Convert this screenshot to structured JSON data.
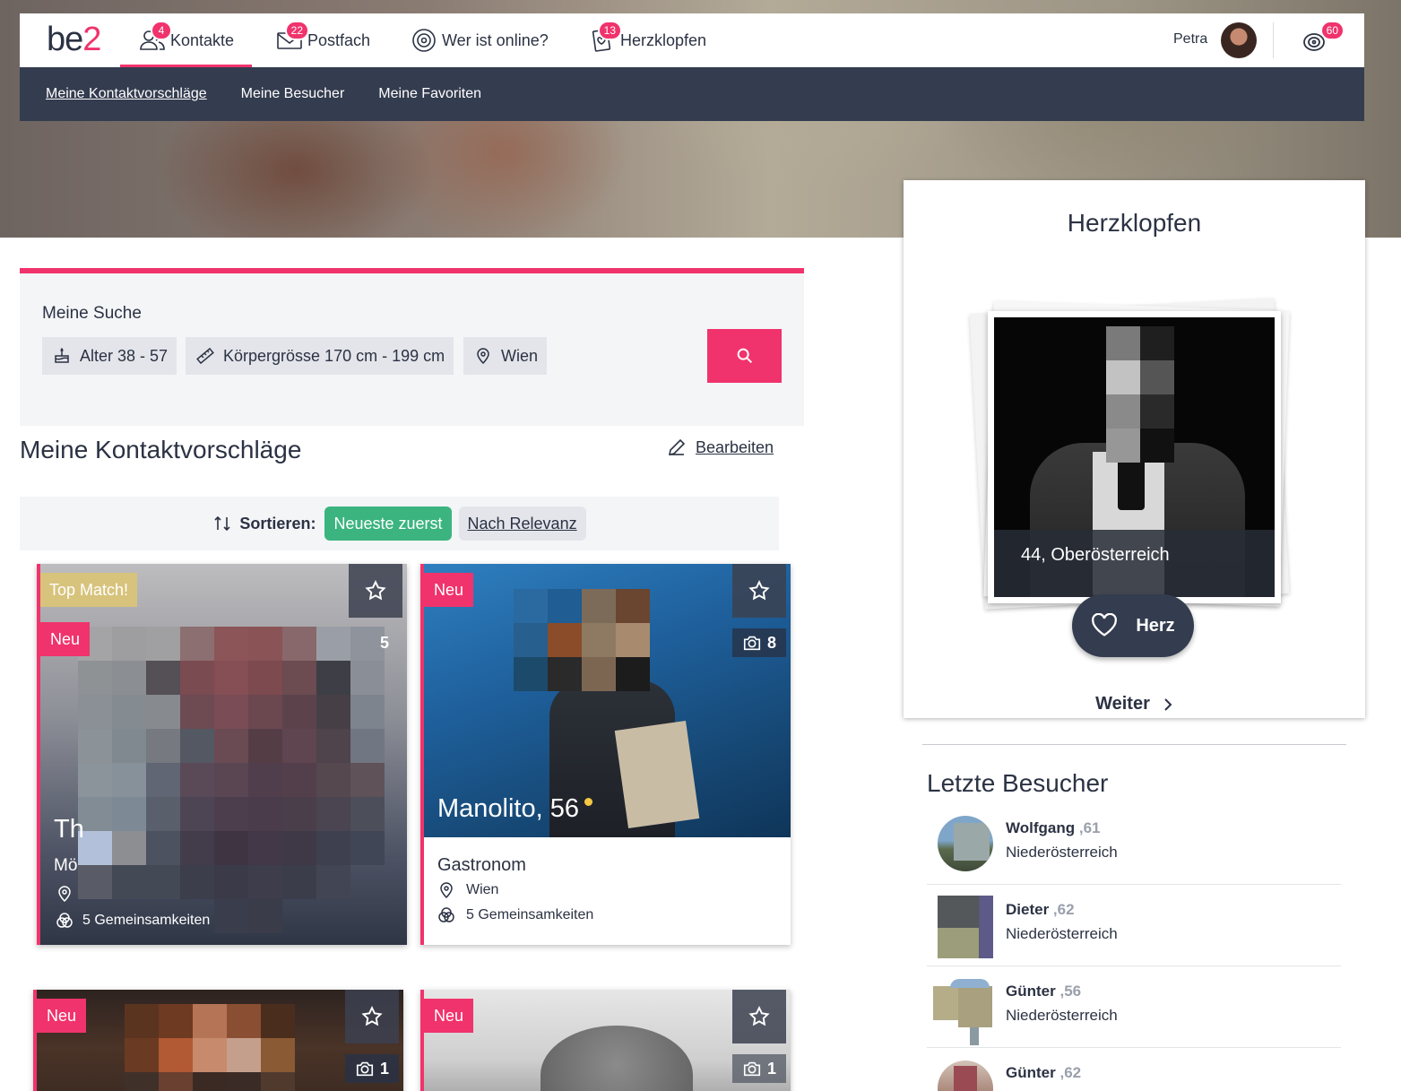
{
  "brand": {
    "logo_text_a": "be",
    "logo_text_b": "2"
  },
  "topnav": {
    "items": [
      {
        "label": "Kontakte",
        "badge": "4"
      },
      {
        "label": "Postfach",
        "badge": "22"
      },
      {
        "label": "Wer ist online?",
        "badge": ""
      },
      {
        "label": "Herzklopfen",
        "badge": "13"
      }
    ],
    "user_name": "Petra",
    "coins_badge": "60"
  },
  "subnav": {
    "items": [
      "Meine Kontaktvorschläge",
      "Meine Besucher",
      "Meine Favoriten"
    ]
  },
  "search": {
    "title": "Meine Suche",
    "chips": [
      "Alter 38 - 57",
      "Körpergrösse 170 cm - 199 cm",
      "Wien"
    ]
  },
  "section": {
    "title": "Meine Kontaktvorschläge",
    "edit_label": "Bearbeiten"
  },
  "sort": {
    "label": "Sortieren:",
    "option_active": "Neueste zuerst",
    "option_other": "Nach Relevanz"
  },
  "cards": [
    {
      "tag_top": "Top Match!",
      "tag_new": "Neu",
      "photos": "5",
      "name_fragment": "Th",
      "job_fragment": "Mö",
      "common": "5 Gemeinsamkeiten"
    },
    {
      "tag_new": "Neu",
      "photos": "8",
      "name": "Manolito, 56",
      "job": "Gastronom",
      "city": "Wien",
      "common": "5 Gemeinsamkeiten"
    },
    {
      "tag_new": "Neu",
      "photos": "1"
    },
    {
      "tag_new": "Neu",
      "photos": "1"
    }
  ],
  "herzklopfen": {
    "title": "Herzklopfen",
    "caption": "44, Oberösterreich",
    "heart_label": "Herz",
    "next_label": "Weiter"
  },
  "visitors": {
    "title": "Letzte Besucher",
    "items": [
      {
        "name": "Wolfgang",
        "age": ",61",
        "region": "Niederösterreich"
      },
      {
        "name": "Dieter",
        "age": ",62",
        "region": "Niederösterreich"
      },
      {
        "name": "Günter",
        "age": ",56",
        "region": "Niederösterreich"
      },
      {
        "name": "Günter",
        "age": ",62",
        "region": ""
      }
    ]
  },
  "colors": {
    "accent": "#f0336c",
    "navy": "#343c4f",
    "green": "#3bb47f",
    "gold": "#d7c37c"
  }
}
